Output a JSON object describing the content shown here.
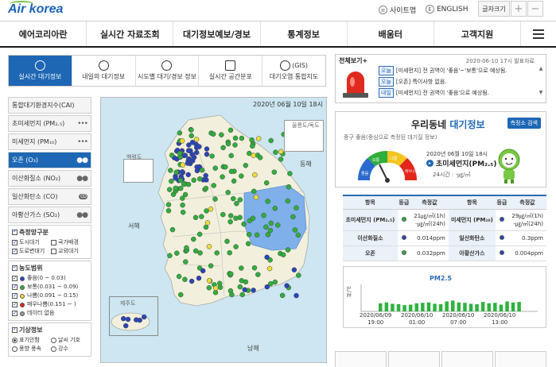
{
  "header": {
    "logo": "Air korea",
    "sitemap": "사이트맵",
    "english": "ENGLISH",
    "fontsize": "글자크기",
    "plus": "+",
    "minus": "−"
  },
  "nav": [
    "에어코리아란",
    "실시간 자료조회",
    "대기정보예보/경보",
    "통계정보",
    "배움터",
    "고객지원"
  ],
  "tabs": [
    "실시간 대기정보",
    "내일의 대기정보",
    "시도별 대기/경보 정보",
    "실시간 공간분포",
    "대기오염 통합지도"
  ],
  "tab_gis": "(GIS)",
  "sidebar": {
    "items": [
      {
        "label": "통합대기환경지수(CAI)",
        "dots": ""
      },
      {
        "label": "초미세먼지 (PM₂.₅)",
        "dots": "•••"
      },
      {
        "label": "미세먼지 (PM₁₀)",
        "dots": "•••"
      },
      {
        "label": "오존 (O₃)",
        "dots": "●●"
      },
      {
        "label": "이산화질소 (NO₂)",
        "dots": "●●"
      },
      {
        "label": "일산화탄소 (CO)",
        "dots": "CO"
      },
      {
        "label": "아황산가스 (SO₂)",
        "dots": "●●"
      }
    ],
    "station_title": "측정망구분",
    "stations": [
      [
        "도시대기",
        "국가배경"
      ],
      [
        "도로변대기",
        "교외대기"
      ]
    ],
    "levels_title": "농도범위",
    "levels": [
      {
        "label": "좋음(0 ~ 0.03)",
        "color": "#2b44b8"
      },
      {
        "label": "보통(0.031 ~ 0.09)",
        "color": "#2fae3c"
      },
      {
        "label": "나쁨(0.091 ~ 0.15)",
        "color": "#f0dc3a"
      },
      {
        "label": "매우나쁨(0.151 ~ )",
        "color": "#e2261c"
      },
      {
        "label": "데이터 없음",
        "color": "#999999"
      }
    ],
    "weather_title": "기상정보",
    "weather": [
      [
        "표기안함",
        "날씨 기호"
      ],
      [
        "풍향 풍속",
        "강수"
      ]
    ]
  },
  "map": {
    "date": "2020년 06월 10일 18시",
    "labels": {
      "ulleung": "울릉도/독도",
      "baekryeong": "백령도",
      "jeju": "제주도",
      "east": "동해",
      "west": "서해",
      "south": "남해"
    }
  },
  "notice": {
    "title": "전체보기+",
    "date": "2020-06-10 17시 발표자료",
    "lines": [
      {
        "tag": "오늘",
        "text": "[미세먼지] 전 권역이 '좋음'~'보통'으로 예상됨."
      },
      {
        "tag": "오늘",
        "text": "[오존] 특이사항 없음."
      },
      {
        "tag": "내일",
        "text": "[미세먼지] 전 권역이 '좋음'으로 예상됨."
      }
    ]
  },
  "woori": {
    "title_prefix": "우리동네",
    "title_suffix": "대기정보",
    "button": "측정소 검색",
    "sub": "중구 좋음(중심으로 측정된 대기질 정보)",
    "sub_station": "중구",
    "date": "2020년 06월 10일 18시",
    "pm_label": "초미세먼지(PM₂.₅)",
    "avg": "24시간 : -㎍/㎥",
    "gauge_labels": [
      "좋음",
      "보통",
      "나쁨",
      "매우나쁨"
    ]
  },
  "table": {
    "headers": [
      "항목",
      "등급",
      "측정값",
      "항목",
      "등급",
      "측정값"
    ],
    "rows": [
      {
        "name1": "초미세먼지 (PM₂.₅)",
        "c1": "#2fae3c",
        "v1": "21㎍/㎥(1h)",
        "v1b": "-㎍/㎥(24h)",
        "name2": "미세먼지 (PM₁₀)",
        "c2": "#2b44b8",
        "v2": "29㎍/㎥(1h)",
        "v2b": "-㎍/㎥(24h)"
      },
      {
        "name1": "이산화질소",
        "c1": "#2b44b8",
        "v1": "0.014ppm",
        "name2": "일산화탄소",
        "c2": "#2b44b8",
        "v2": "0.3ppm"
      },
      {
        "name1": "오존",
        "c1": "#2fae3c",
        "v1": "0.032ppm",
        "name2": "아황산가스",
        "c2": "#2b44b8",
        "v2": "0.004ppm"
      }
    ]
  },
  "chart_data": {
    "type": "bar",
    "title": "PM2.5",
    "ylabel": "㎍/㎥",
    "ylim": [
      0,
      60
    ],
    "x_ticks": [
      "2020/06/09\n19:00",
      "2020/06/10\n01:00",
      "2020/06/10\n07:00",
      "2020/06/10\n13:00"
    ],
    "values": [
      18,
      20,
      17,
      16,
      14,
      15,
      18,
      19,
      20,
      17,
      16,
      22,
      24,
      20,
      19,
      17,
      16,
      21,
      18,
      19,
      15,
      22,
      20,
      21
    ],
    "colors": {
      "good": "#2fb33f",
      "normal": "#2fb33f"
    }
  },
  "colors": {
    "accent": "#1d67b5",
    "good": "#2b44b8",
    "normal": "#2fae3c",
    "bad": "#f0dc3a",
    "very_bad": "#e2261c"
  }
}
